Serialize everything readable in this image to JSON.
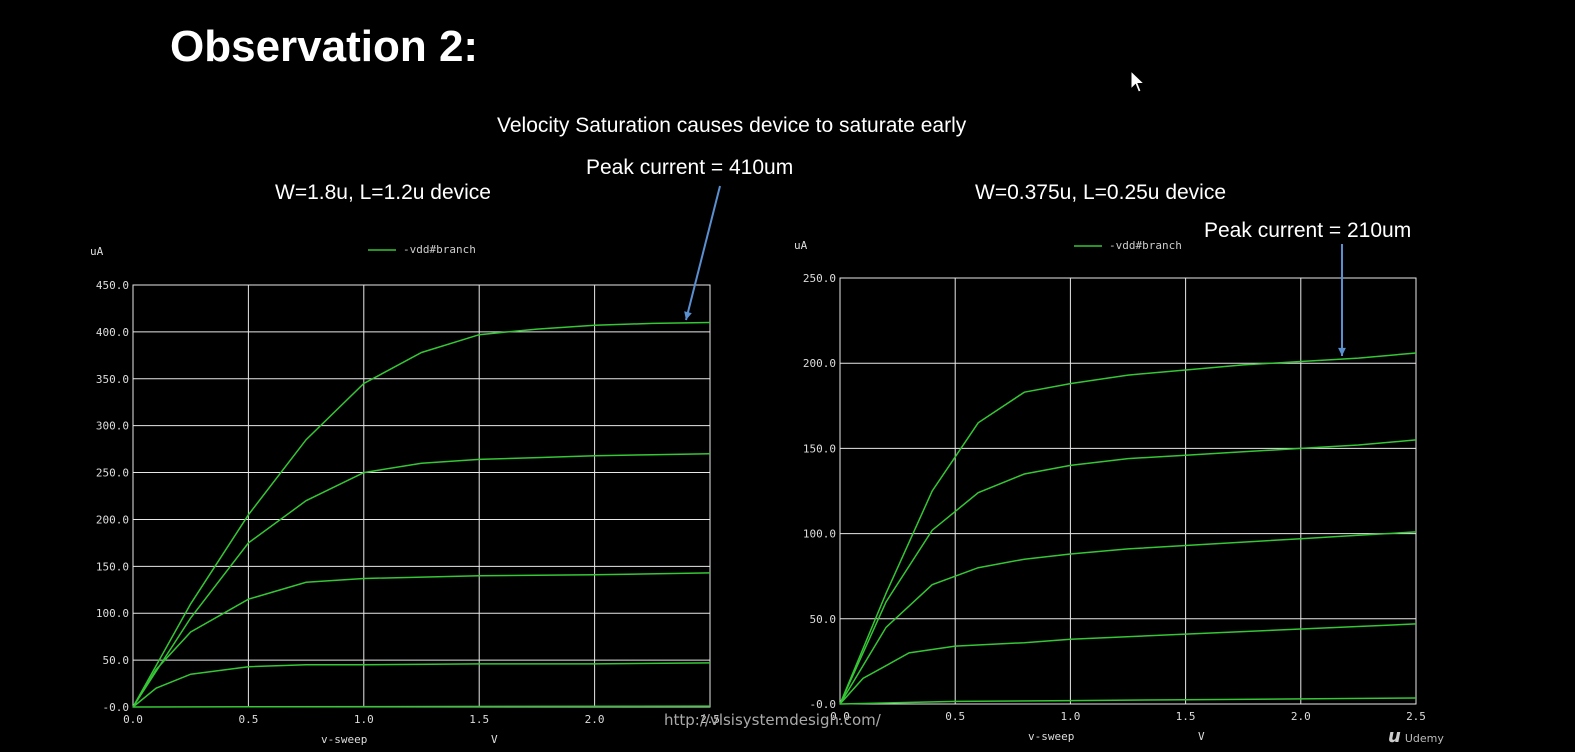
{
  "slide": {
    "title": "Observation 2:",
    "headline": "Velocity Saturation causes device to saturate early",
    "left_annotation": "Peak current = 410um",
    "right_annotation": "Peak current = 210um",
    "left_caption": "W=1.8u, L=1.2u device",
    "right_caption": "W=0.375u, L=0.25u device",
    "watermark": "http://vlsisystemdesign.com/",
    "brand": "Udemy"
  },
  "colors": {
    "background": "#000000",
    "grid": "#e8e8e8",
    "trace": "#35c635",
    "arrow": "#5a8fd0"
  },
  "chart_data": [
    {
      "type": "line",
      "title": "",
      "xlabel": "v-sweep",
      "xunit": "V",
      "ylabel": "uA",
      "legend": "-vdd#branch",
      "legend_position": "top-center",
      "grid": true,
      "xlim": [
        0,
        2.5
      ],
      "ylim": [
        0,
        450
      ],
      "xticks": [
        "0.0",
        "0.5",
        "1.0",
        "1.5",
        "2.0",
        "2.5"
      ],
      "yticks": [
        "-0.0",
        "50.0",
        "100.0",
        "150.0",
        "200.0",
        "250.0",
        "300.0",
        "350.0",
        "400.0",
        "450.0"
      ],
      "series": [
        {
          "x": [
            0,
            0.25,
            0.5,
            0.75,
            1.0,
            1.25,
            1.5,
            1.75,
            2.0,
            2.25,
            2.5
          ],
          "values": [
            0,
            110,
            205,
            285,
            345,
            378,
            397,
            403,
            407,
            409,
            410
          ]
        },
        {
          "x": [
            0,
            0.25,
            0.5,
            0.75,
            1.0,
            1.25,
            1.5,
            1.75,
            2.0,
            2.25,
            2.5
          ],
          "values": [
            0,
            95,
            175,
            220,
            250,
            260,
            264,
            266,
            268,
            269,
            270
          ]
        },
        {
          "x": [
            0,
            0.1,
            0.25,
            0.5,
            0.75,
            1.0,
            1.5,
            2.0,
            2.5
          ],
          "values": [
            0,
            40,
            80,
            115,
            133,
            137,
            140,
            141,
            143
          ]
        },
        {
          "x": [
            0,
            0.1,
            0.25,
            0.5,
            0.75,
            1.0,
            1.5,
            2.0,
            2.5
          ],
          "values": [
            0,
            20,
            35,
            43,
            45,
            45,
            46,
            46,
            47
          ]
        },
        {
          "x": [
            0,
            2.5
          ],
          "values": [
            0,
            1
          ]
        }
      ]
    },
    {
      "type": "line",
      "title": "",
      "xlabel": "v-sweep",
      "xunit": "V",
      "ylabel": "uA",
      "legend": "-vdd#branch",
      "legend_position": "top-center",
      "grid": true,
      "xlim": [
        0,
        2.5
      ],
      "ylim": [
        0,
        250
      ],
      "xticks": [
        "0.0",
        "0.5",
        "1.0",
        "1.5",
        "2.0",
        "2.5"
      ],
      "yticks": [
        "-0.0",
        "50.0",
        "100.0",
        "150.0",
        "200.0",
        "250.0"
      ],
      "series": [
        {
          "x": [
            0,
            0.2,
            0.4,
            0.6,
            0.8,
            1.0,
            1.25,
            1.5,
            1.75,
            2.0,
            2.25,
            2.5
          ],
          "values": [
            0,
            65,
            125,
            165,
            183,
            188,
            193,
            196,
            199,
            201,
            203,
            206
          ]
        },
        {
          "x": [
            0,
            0.2,
            0.4,
            0.6,
            0.8,
            1.0,
            1.25,
            1.5,
            1.75,
            2.0,
            2.25,
            2.5
          ],
          "values": [
            0,
            60,
            102,
            124,
            135,
            140,
            144,
            146,
            148,
            150,
            152,
            155
          ]
        },
        {
          "x": [
            0,
            0.2,
            0.4,
            0.6,
            0.8,
            1.0,
            1.25,
            1.5,
            1.75,
            2.0,
            2.25,
            2.5
          ],
          "values": [
            0,
            45,
            70,
            80,
            85,
            88,
            91,
            93,
            95,
            97,
            99,
            101
          ]
        },
        {
          "x": [
            0,
            0.1,
            0.3,
            0.5,
            0.8,
            1.0,
            1.5,
            2.0,
            2.5
          ],
          "values": [
            0,
            15,
            30,
            34,
            36,
            38,
            41,
            44,
            47
          ]
        },
        {
          "x": [
            0,
            0.5,
            1.0,
            1.5,
            2.0,
            2.5
          ],
          "values": [
            0,
            1.5,
            2,
            2.5,
            3,
            3.5
          ]
        }
      ]
    }
  ]
}
